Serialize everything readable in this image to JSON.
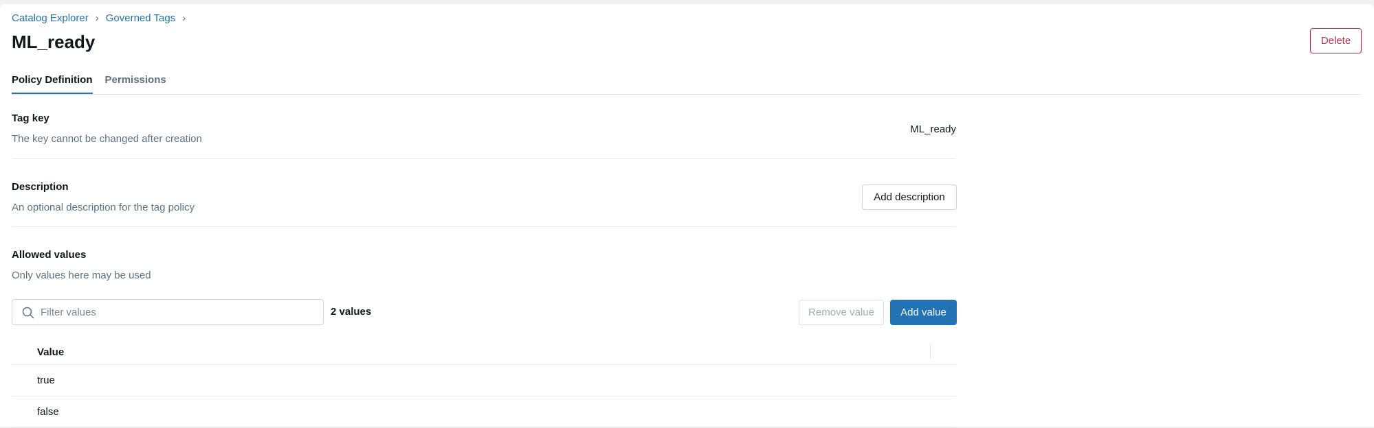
{
  "breadcrumb": {
    "items": [
      "Catalog Explorer",
      "Governed Tags"
    ],
    "separator": "›"
  },
  "page": {
    "title": "ML_ready"
  },
  "header": {
    "delete_label": "Delete"
  },
  "tabs": [
    {
      "label": "Policy Definition",
      "active": true
    },
    {
      "label": "Permissions",
      "active": false
    }
  ],
  "tag_key": {
    "label": "Tag key",
    "description": "The key cannot be changed after creation",
    "value": "ML_ready"
  },
  "description": {
    "label": "Description",
    "description": "An optional description for the tag policy",
    "button_label": "Add description"
  },
  "allowed_values": {
    "label": "Allowed values",
    "description": "Only values here may be used",
    "filter_placeholder": "Filter values",
    "count_text": "2 values",
    "remove_label": "Remove value",
    "add_label": "Add value",
    "table": {
      "column_header": "Value",
      "rows": [
        "true",
        "false"
      ]
    }
  },
  "colors": {
    "accent": "#2272b4",
    "danger": "#c82d4c"
  }
}
